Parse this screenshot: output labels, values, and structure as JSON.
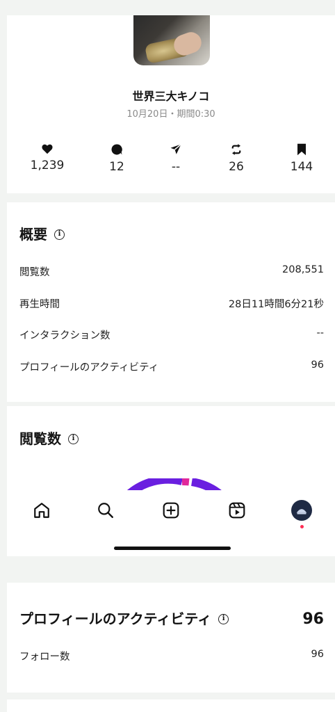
{
  "post": {
    "title": "世界三大キノコ",
    "date_duration": "10月20日・期間0:30"
  },
  "engagement": {
    "likes": "1,239",
    "comments": "12",
    "shares": "--",
    "reposts": "26",
    "saves": "144"
  },
  "overview": {
    "title": "概要",
    "rows": [
      {
        "label": "閲覧数",
        "value": "208,551"
      },
      {
        "label": "再生時間",
        "value": "28日11時間6分21秒"
      },
      {
        "label": "インタラクション数",
        "value": "--"
      },
      {
        "label": "プロフィールのアクティビティ",
        "value": "96"
      }
    ]
  },
  "views": {
    "title": "閲覧数"
  },
  "profile_activity": {
    "title": "プロフィールのアクティビティ",
    "total": "96",
    "rows": [
      {
        "label": "フォロー数",
        "value": "96"
      }
    ]
  },
  "colors": {
    "accent_purple": "#6a1fe0",
    "accent_pink": "#e0289a",
    "notification_dot": "#ff2d55"
  },
  "icons": {
    "likes": "heart-icon",
    "comments": "comment-icon",
    "shares": "send-icon",
    "reposts": "repost-icon",
    "saves": "bookmark-icon",
    "info": "info-icon",
    "nav": [
      "home-icon",
      "search-icon",
      "create-icon",
      "reels-icon",
      "profile-avatar"
    ]
  }
}
